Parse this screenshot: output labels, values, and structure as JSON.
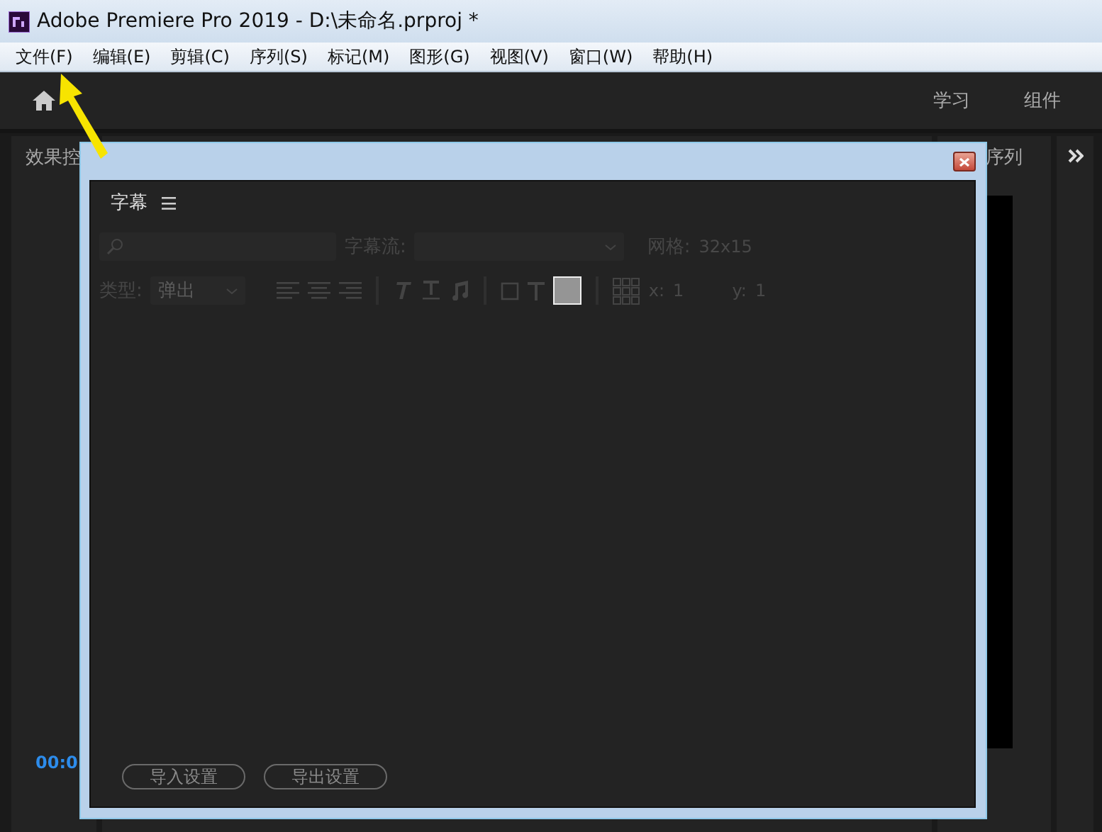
{
  "window": {
    "title": "Adobe Premiere Pro 2019 - D:\\未命名.prproj *"
  },
  "menu": [
    "文件(F)",
    "编辑(E)",
    "剪辑(C)",
    "序列(S)",
    "标记(M)",
    "图形(G)",
    "视图(V)",
    "窗口(W)",
    "帮助(H)"
  ],
  "workspaces": [
    "学习",
    "组件"
  ],
  "left_panel": {
    "tab": "效果控",
    "timecode": "00:0"
  },
  "right_panel": {
    "tab": "序列"
  },
  "dialog": {
    "panel_title": "字幕",
    "stream_label": "字幕流:",
    "grid_label": "网格:",
    "grid_value": "32x15",
    "type_label": "类型:",
    "type_value": "弹出",
    "x_label": "x:",
    "x_value": "1",
    "y_label": "y:",
    "y_value": "1",
    "buttons": [
      "导入设置",
      "导出设置"
    ]
  }
}
